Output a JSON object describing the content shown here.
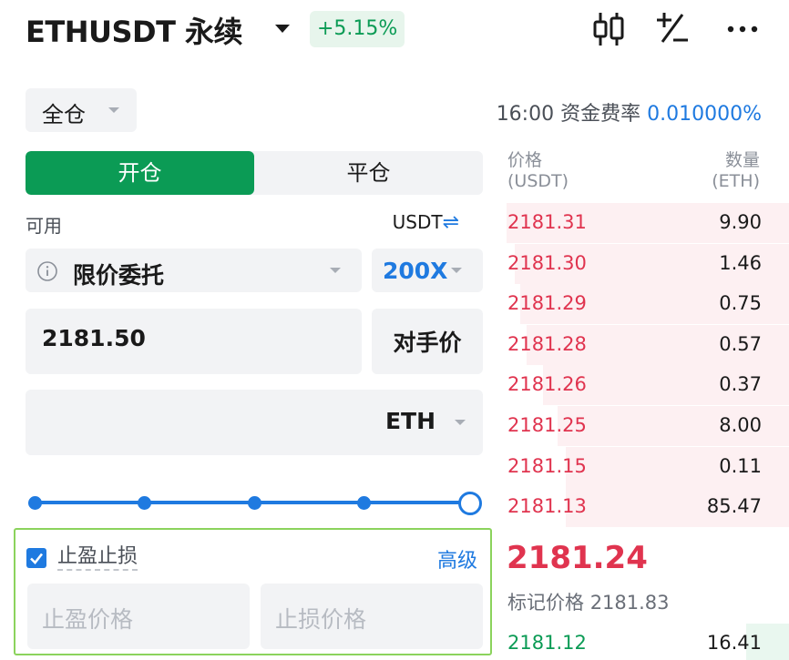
{
  "header": {
    "symbol": "ETHUSDT 永续",
    "change": "+5.15%",
    "icons": [
      "candlestick-chart-icon",
      "plus-minus-icon",
      "more-icon"
    ]
  },
  "margin_mode": {
    "label": "全仓"
  },
  "funding": {
    "time": "16:00",
    "label": "资金费率",
    "rate": "0.010000%"
  },
  "tabs": {
    "open": "开仓",
    "close": "平仓"
  },
  "available": {
    "label": "可用",
    "unit": "USDT"
  },
  "order_type": {
    "label": "限价委托"
  },
  "leverage": {
    "label": "200X"
  },
  "price": {
    "value": "2181.50",
    "counterparty_label": "对手价"
  },
  "quantity": {
    "unit": "ETH"
  },
  "slider": {
    "level_percent": 100
  },
  "tpsl": {
    "checked": true,
    "label": "止盈止损",
    "advanced": "高级",
    "tp_placeholder": "止盈价格",
    "sl_placeholder": "止损价格"
  },
  "orderbook": {
    "price_header": "价格",
    "price_unit": "(USDT)",
    "qty_header": "数量",
    "qty_unit": "(ETH)",
    "asks": [
      {
        "price": "2181.31",
        "qty": "9.90",
        "depth": 1.0
      },
      {
        "price": "2181.30",
        "qty": "1.46",
        "depth": 0.97
      },
      {
        "price": "2181.29",
        "qty": "0.75",
        "depth": 0.95
      },
      {
        "price": "2181.28",
        "qty": "0.57",
        "depth": 0.93
      },
      {
        "price": "2181.26",
        "qty": "0.37",
        "depth": 0.87
      },
      {
        "price": "2181.25",
        "qty": "8.00",
        "depth": 0.82
      },
      {
        "price": "2181.15",
        "qty": "0.11",
        "depth": 0.79
      },
      {
        "price": "2181.13",
        "qty": "85.47",
        "depth": 0.79
      }
    ],
    "last_price": "2181.24",
    "mark_label": "标记价格",
    "mark_price": "2181.83",
    "bids": [
      {
        "price": "2181.12",
        "qty": "16.41",
        "depth": 0.15
      }
    ]
  },
  "colors": {
    "brand_green": "#0b9b55",
    "ask_red": "#e0344f",
    "accent_blue": "#1f7ae0",
    "tpsl_border": "#8bd35c"
  }
}
